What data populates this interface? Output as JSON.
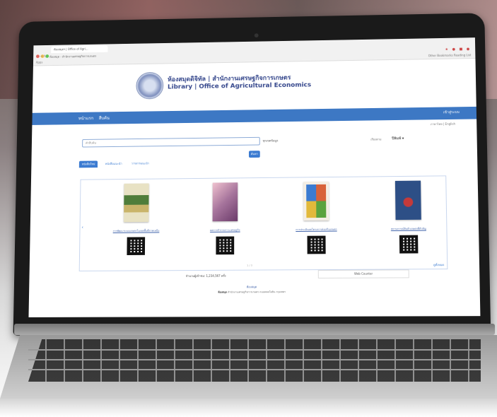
{
  "browser": {
    "tab_title": "ห้องสมุดฯ | Office of Agri...",
    "nav": "← → ↻",
    "address": "ห้องสมุด - สำนักงานเศรษฐกิจการเกษตร",
    "bookmark_left": "Apps",
    "bookmark_right": "Other Bookmarks   Reading List"
  },
  "site": {
    "title_th": "ห้องสมุดดิจิทัล | สำนักงานเศรษฐกิจการเกษตร",
    "title_en": "Library | Office of Agricultural Economics"
  },
  "menu": {
    "home": "หน้าแรก",
    "item2": "สืบค้น",
    "right": "เข้าสู่ระบบ"
  },
  "subbar": {
    "lang": "ภาษาไทย | English"
  },
  "search": {
    "placeholder": "คำสืบค้น",
    "type": "ทุกเขตข้อมูล",
    "sort_label": "เรียงตาม",
    "sort_value": "ปีพิมพ์ ▾",
    "button": "ค้นหา"
  },
  "tabs": [
    "หนังสือใหม่",
    "หนังสือแนะนำ",
    "วารสารแนะนำ"
  ],
  "books": [
    {
      "title": "การพัฒนาระบบเกษตรในเขตพื้นที่ภาคเหนือ",
      "color1": "#e8e2c4",
      "color2": "#4f7d3a"
    },
    {
      "title": "ผลการสำรวจภาวะเศรษฐกิจ",
      "color1": "#f0c2cf",
      "color2": "#6b3b6a"
    },
    {
      "title": "การประเมินผลโครงการส่งเสริมเกษตร",
      "color1": "#f4eee4",
      "color2": "#d8623a"
    },
    {
      "title": "สถานการณ์สินค้าเกษตรที่สำคัญ",
      "color1": "#2d4f86",
      "color2": "#c43a3a"
    }
  ],
  "carousel": {
    "more": "ดูทั้งหมด",
    "pager": "1 / 3"
  },
  "footer": {
    "visits_label": "จำนวนผู้เข้าชม: 1,234,567 ครั้ง",
    "counter": "Web Counter",
    "link": "ห้องสมุด",
    "text_bold": "ห้องสมุด",
    "text": "สำนักงานเศรษฐกิจการเกษตร  ถนนพหลโยธิน  กรุงเทพฯ"
  }
}
